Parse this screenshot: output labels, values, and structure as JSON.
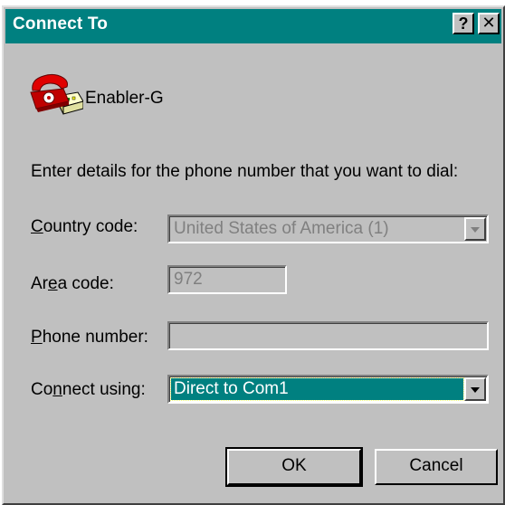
{
  "window": {
    "title": "Connect To",
    "help_button": "?",
    "close_button": "✕"
  },
  "connection": {
    "name": "Enabler-G",
    "icon": "telephone-modem-icon"
  },
  "instruction": "Enter details for the phone number that you want to dial:",
  "fields": {
    "country_code": {
      "label_pre": "",
      "label_key": "C",
      "label_post": "ountry code:",
      "value": "United States of America (1)",
      "enabled": false
    },
    "area_code": {
      "label_pre": "Ar",
      "label_key": "e",
      "label_post": "a code:",
      "value": "972",
      "enabled": false
    },
    "phone_number": {
      "label_pre": "",
      "label_key": "P",
      "label_post": "hone number:",
      "value": "",
      "enabled": false
    },
    "connect_using": {
      "label_pre": "Co",
      "label_key": "n",
      "label_post": "nect using:",
      "value": "Direct to Com1",
      "enabled": true
    }
  },
  "buttons": {
    "ok": "OK",
    "cancel": "Cancel"
  },
  "colors": {
    "title_bar": "#008080",
    "face": "#c0c0c0",
    "selection": "#008080"
  }
}
